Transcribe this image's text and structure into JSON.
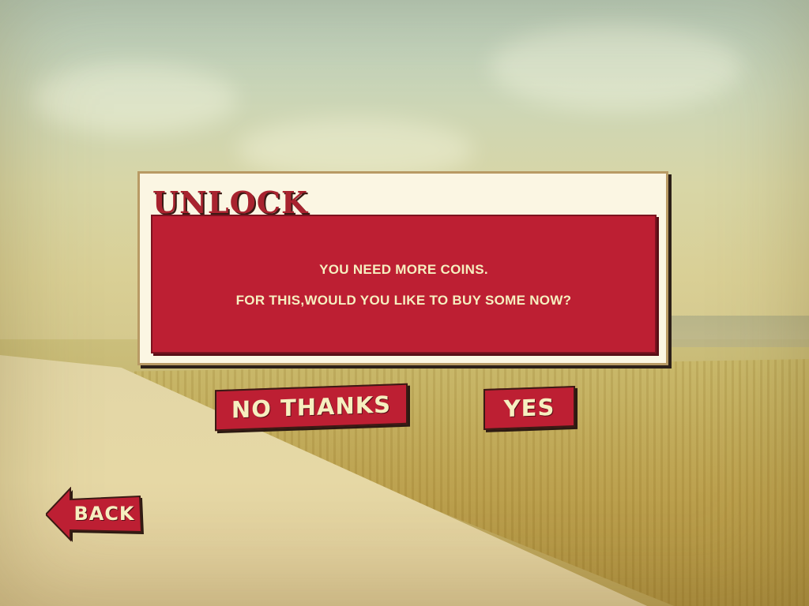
{
  "dialog": {
    "title": "UNLOCK",
    "message_line1": "YOU NEED MORE COINS.",
    "message_line2": "FOR THIS,WOULD YOU LIKE TO BUY SOME NOW?"
  },
  "buttons": {
    "no_thanks": "NO THANKS",
    "yes": "YES",
    "back": "BACK"
  },
  "colors": {
    "accent_red": "#bd1f33",
    "text_cream": "#f6efc0",
    "panel_cream": "#fbf6e3"
  },
  "icons": {
    "back": "arrow-left-icon"
  }
}
